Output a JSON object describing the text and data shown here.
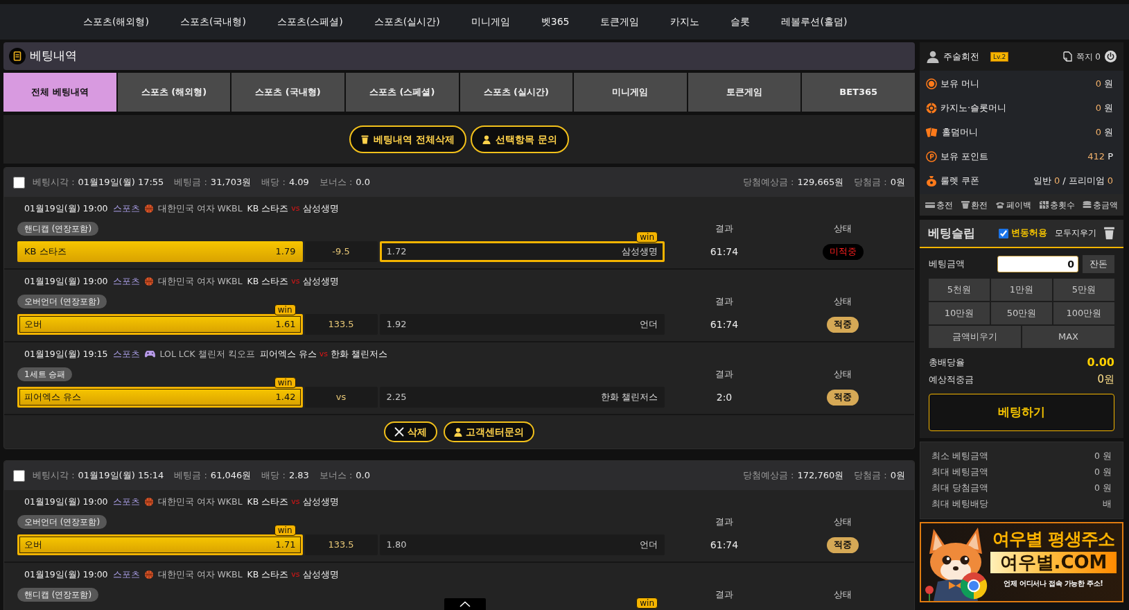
{
  "nav": {
    "items": [
      "스포츠(해외형)",
      "스포츠(국내형)",
      "스포츠(스페셜)",
      "스포츠(실시간)",
      "미니게임",
      "벳365",
      "토큰게임",
      "카지노",
      "슬롯",
      "레볼루션(홀덤)"
    ]
  },
  "page_header": {
    "title": "베팅내역"
  },
  "tabs": [
    {
      "label": "전체 베팅내역",
      "selected": true
    },
    {
      "label": "스포츠 (해외형)",
      "selected": false
    },
    {
      "label": "스포츠 (국내형)",
      "selected": false
    },
    {
      "label": "스포츠 (스페셜)",
      "selected": false
    },
    {
      "label": "스포츠 (실시간)",
      "selected": false
    },
    {
      "label": "미니게임",
      "selected": false
    },
    {
      "label": "토큰게임",
      "selected": false
    },
    {
      "label": "BET365",
      "selected": false
    }
  ],
  "bulk_actions": [
    {
      "kind": "delete_all",
      "label": "베팅내역 전체삭제"
    },
    {
      "kind": "inquiry",
      "label": "선택항목 문의"
    }
  ],
  "bets": [
    {
      "checked": false,
      "info": [
        {
          "label": "베팅시각 :",
          "value": "01월19일(월) 17:55"
        },
        {
          "label": "베팅금 :",
          "value": "31,703원"
        },
        {
          "label": "배당 :",
          "value": "4.09"
        },
        {
          "label": "보너스 :",
          "value": "0.0"
        }
      ],
      "payout": [
        {
          "label": "당첨예상금 :",
          "value": "129,665원"
        },
        {
          "label": "당첨금 :",
          "value": "0원"
        }
      ],
      "rows": [
        {
          "time": "01월19일(월) 19:00",
          "category": "스포츠",
          "kind": "basketball",
          "league": "대한민국 여자 WKBL",
          "home_team": "KB 스타즈",
          "vs": "vs",
          "away_team": "삼성생명",
          "market": "핸디캡 (연장포함)",
          "home": {
            "label": "KB 스타즈",
            "odds": "1.79",
            "picked": true,
            "win": false
          },
          "line": "-9.5",
          "away": {
            "label": "삼성생명",
            "odds": "1.72",
            "picked": false,
            "win": true,
            "tag": "win"
          },
          "result_label": "결과",
          "result": "61:74",
          "status_label": "상태",
          "status": {
            "text": "미적중",
            "kind": "miss"
          }
        },
        {
          "time": "01월19일(월) 19:00",
          "category": "스포츠",
          "kind": "basketball",
          "league": "대한민국 여자 WKBL",
          "home_team": "KB 스타즈",
          "vs": "vs",
          "away_team": "삼성생명",
          "market": "오버언더 (연장포함)",
          "home": {
            "label": "오버",
            "odds": "1.61",
            "picked": true,
            "win": true,
            "tag": "win"
          },
          "line": "133.5",
          "away": {
            "label": "언더",
            "odds": "1.92",
            "picked": false,
            "win": false
          },
          "result_label": "결과",
          "result": "61:74",
          "status_label": "상태",
          "status": {
            "text": "적중",
            "kind": "hit"
          }
        },
        {
          "time": "01월19일(월) 19:15",
          "category": "스포츠",
          "kind": "esports",
          "league": "LOL LCK 챌린저 킥오프",
          "home_team": "피어엑스 유스",
          "vs": "vs",
          "away_team": "한화 챌린저스",
          "market": "1세트 승패",
          "home": {
            "label": "피어엑스 유스",
            "odds": "1.42",
            "picked": true,
            "win": true,
            "tag": "win"
          },
          "line": "vs",
          "away": {
            "label": "한화 챌린저스",
            "odds": "2.25",
            "picked": false,
            "win": false
          },
          "result_label": "결과",
          "result": "2:0",
          "status_label": "상태",
          "status": {
            "text": "적중",
            "kind": "hit"
          }
        }
      ],
      "actions": [
        {
          "kind": "delete",
          "label": "삭제"
        },
        {
          "kind": "inquiry",
          "label": "고객센터문의"
        }
      ]
    },
    {
      "checked": false,
      "info": [
        {
          "label": "베팅시각 :",
          "value": "01월19일(월) 15:14"
        },
        {
          "label": "베팅금 :",
          "value": "61,046원"
        },
        {
          "label": "배당 :",
          "value": "2.83"
        },
        {
          "label": "보너스 :",
          "value": "0.0"
        }
      ],
      "payout": [
        {
          "label": "당첨예상금 :",
          "value": "172,760원"
        },
        {
          "label": "당첨금 :",
          "value": "0원"
        }
      ],
      "rows": [
        {
          "time": "01월19일(월) 19:00",
          "category": "스포츠",
          "kind": "basketball",
          "league": "대한민국 여자 WKBL",
          "home_team": "KB 스타즈",
          "vs": "vs",
          "away_team": "삼성생명",
          "market": "오버언더 (연장포함)",
          "home": {
            "label": "오버",
            "odds": "1.71",
            "picked": true,
            "win": true,
            "tag": "win"
          },
          "line": "133.5",
          "away": {
            "label": "언더",
            "odds": "1.80",
            "picked": false,
            "win": false
          },
          "result_label": "결과",
          "result": "61:74",
          "status_label": "상태",
          "status": {
            "text": "적중",
            "kind": "hit"
          }
        },
        {
          "time": "01월19일(월) 19:00",
          "category": "스포츠",
          "kind": "basketball",
          "league": "대한민국 여자 WKBL",
          "home_team": "KB 스타즈",
          "vs": "vs",
          "away_team": "삼성생명",
          "market": "핸디캡 (연장포함)",
          "away": {
            "win": true,
            "tag": "win"
          },
          "result_label": "결과",
          "status_label": "상태"
        }
      ]
    }
  ],
  "sidebar": {
    "user": {
      "name": "주술회전",
      "level": "Lv.2",
      "messages": "쪽지 0"
    },
    "wallet": [
      {
        "kind": "money",
        "label": "보유 머니",
        "value": [
          {
            "text": "0",
            "kind": "amount"
          },
          {
            "text": "원",
            "kind": "unit"
          }
        ]
      },
      {
        "kind": "casino",
        "label": "카지노·슬롯머니",
        "value": [
          {
            "text": "0",
            "kind": "amount"
          },
          {
            "text": "원",
            "kind": "unit"
          }
        ]
      },
      {
        "kind": "holdem",
        "label": "홀덤머니",
        "value": [
          {
            "text": "0",
            "kind": "amount"
          },
          {
            "text": "원",
            "kind": "unit"
          }
        ]
      },
      {
        "kind": "point",
        "label": "보유 포인트",
        "value": [
          {
            "text": "412",
            "kind": "amount"
          },
          {
            "text": "P",
            "kind": "unit"
          }
        ]
      },
      {
        "kind": "coupon",
        "label": "룰렛 쿠폰",
        "value": [
          {
            "text": "일반",
            "kind": "unit"
          },
          {
            "text": "0",
            "kind": "amount"
          },
          {
            "text": "/",
            "kind": "unit"
          },
          {
            "text": "프리미엄",
            "kind": "unit"
          },
          {
            "text": "0",
            "kind": "amount"
          }
        ]
      }
    ],
    "quick_links": [
      {
        "kind": "deposit",
        "label": "충전"
      },
      {
        "kind": "withdraw",
        "label": "환전"
      },
      {
        "kind": "payback",
        "label": "페이백"
      },
      {
        "kind": "count",
        "label": "충횟수"
      },
      {
        "kind": "total",
        "label": "충금액"
      }
    ],
    "bet_slip": {
      "title": "베팅슬립",
      "allow_change": {
        "label": "변동허용",
        "checked": true
      },
      "clear_all": "모두지우기",
      "amount_label": "베팅금액",
      "amount_value": "0",
      "change_button": "잔돈",
      "quick_amounts": [
        "5천원",
        "1만원",
        "5만원",
        "10만원",
        "50만원",
        "100만원"
      ],
      "extra_buttons": [
        "금액비우기",
        "MAX"
      ],
      "totals": [
        {
          "kind": "odds",
          "label": "총배당율",
          "value": "0.00"
        },
        {
          "kind": "payout",
          "label": "예상적중금",
          "value": "0원"
        }
      ],
      "submit": "베팅하기"
    },
    "limits": [
      {
        "label": "최소 베팅금액",
        "value": "0 원"
      },
      {
        "label": "최대 베팅금액",
        "value": "0 원"
      },
      {
        "label": "최대 당첨금액",
        "value": "0 원"
      },
      {
        "label": "최대 베팅배당",
        "value": "배"
      }
    ],
    "banner": {
      "title": "여우별 평생주소",
      "domain": "여우별.COM",
      "tagline": "언제 어디서나 접속 가능한 주소!"
    }
  }
}
